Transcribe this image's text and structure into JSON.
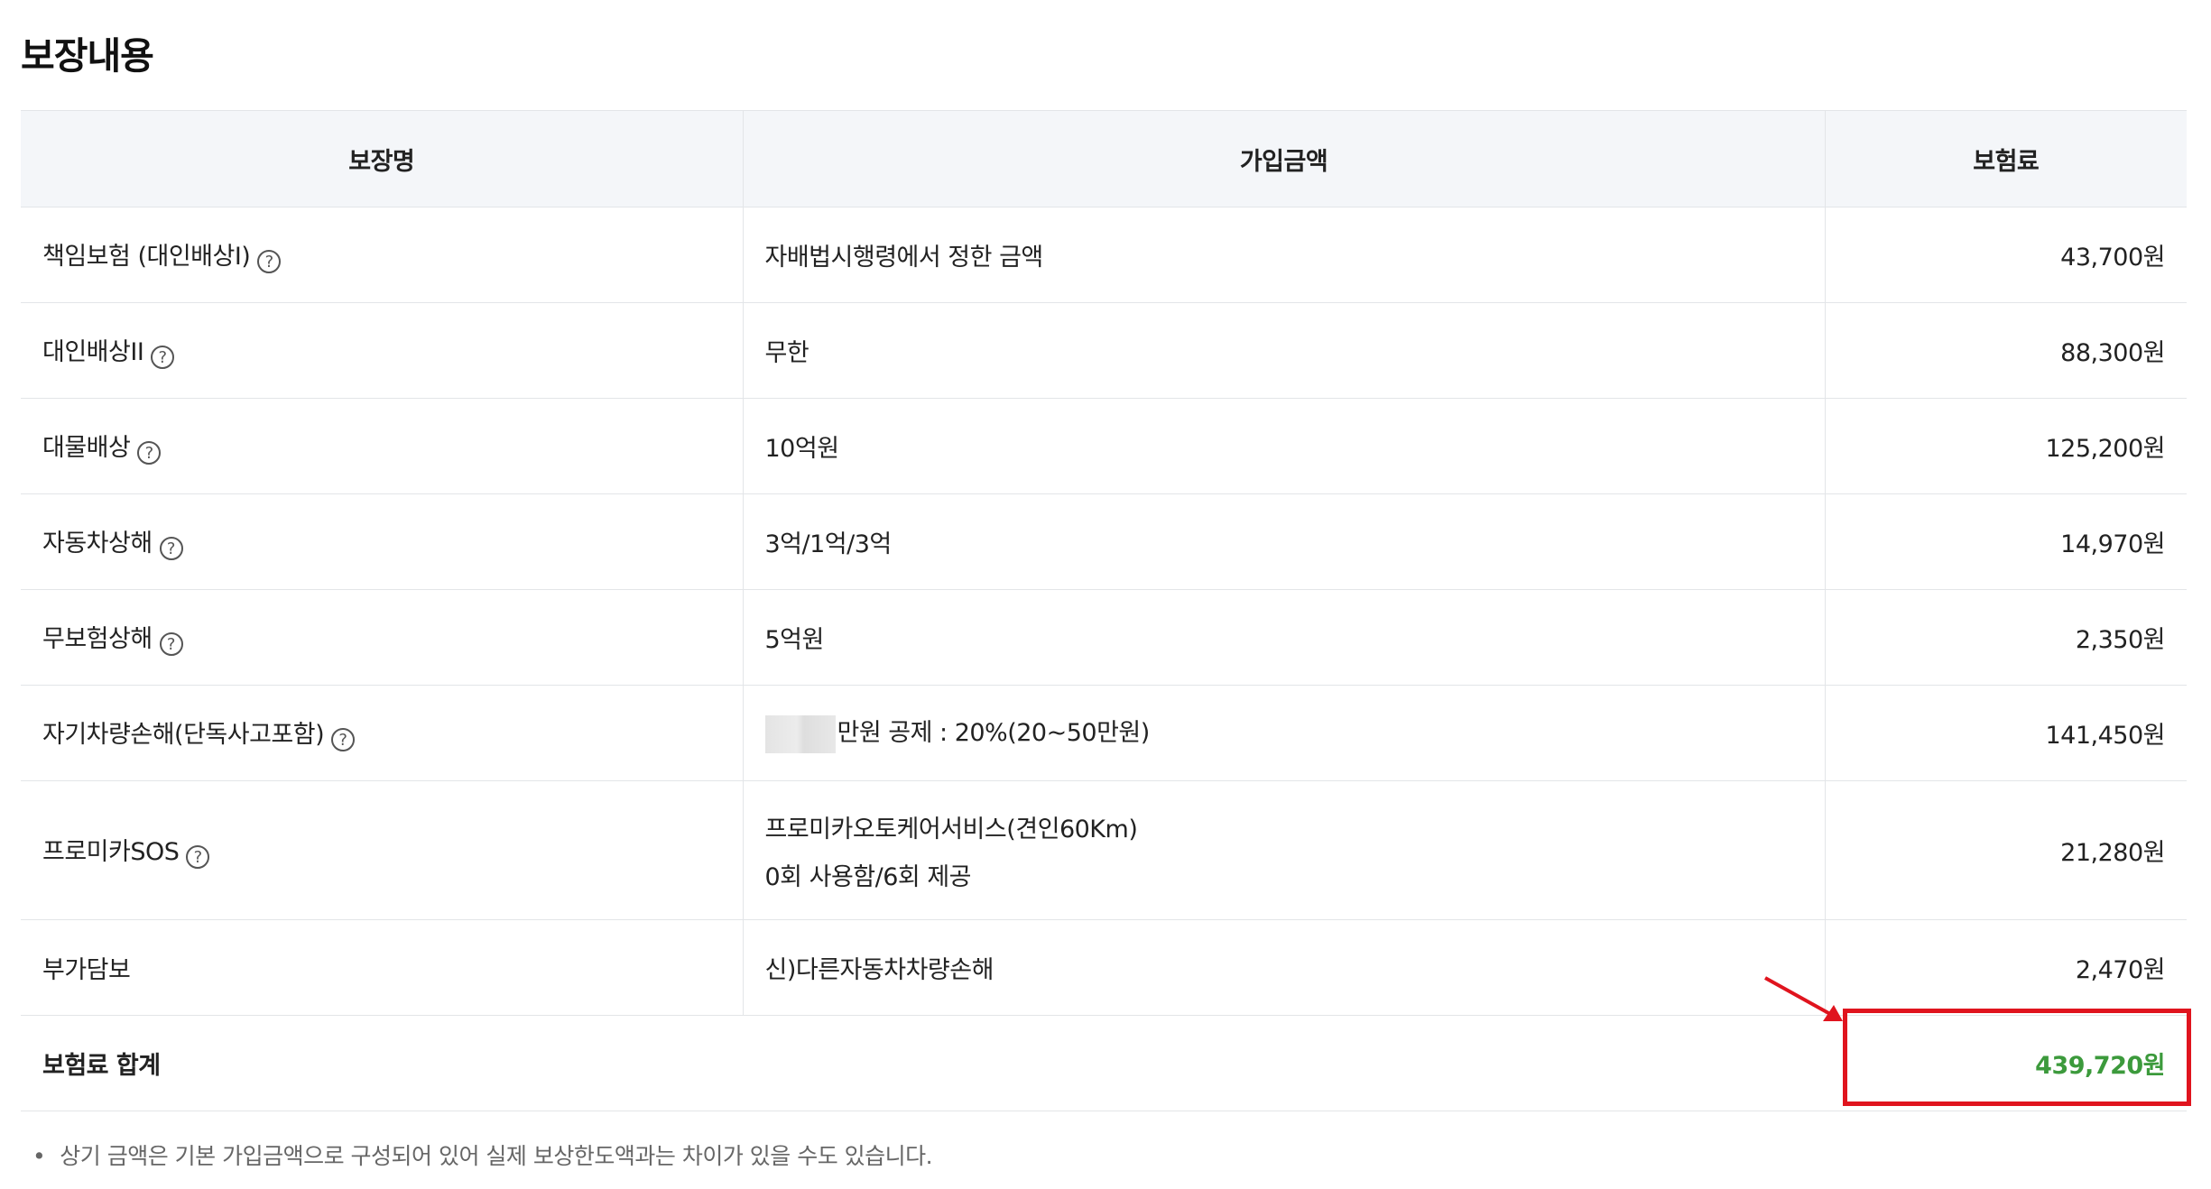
{
  "title": "보장내용",
  "table": {
    "headers": [
      "보장명",
      "가입금액",
      "보험료"
    ],
    "rows": [
      {
        "name": "책임보험 (대인배상I)",
        "has_help": true,
        "amount": "자배법시행령에서 정한 금액",
        "premium": "43,700원"
      },
      {
        "name": "대인배상II",
        "has_help": true,
        "amount": "무한",
        "premium": "88,300원"
      },
      {
        "name": "대물배상",
        "has_help": true,
        "amount": "10억원",
        "premium": "125,200원"
      },
      {
        "name": "자동차상해",
        "has_help": true,
        "amount": "3억/1억/3억",
        "premium": "14,970원"
      },
      {
        "name": "무보험상해",
        "has_help": true,
        "amount": "5억원",
        "premium": "2,350원"
      },
      {
        "name": "자기차량손해(단독사고포함)",
        "has_help": true,
        "amount": "만원 공제 : 20%(20~50만원)",
        "premium": "141,450원"
      },
      {
        "name": "프로미카SOS",
        "has_help": true,
        "amount": "프로미카오토케어서비스(견인60Km)",
        "amount_line2": "0회 사용함/6회 제공",
        "premium": "21,280원"
      },
      {
        "name": "부가담보",
        "has_help": false,
        "amount": "신)다른자동차차량손해",
        "premium": "2,470원"
      }
    ],
    "total": {
      "label": "보험료 합계",
      "value": "439,720원"
    }
  },
  "help_icon": {
    "glyph": "?",
    "icon": "question-circle-icon"
  },
  "note": {
    "bullet": "•",
    "text": "상기 금액은 기본 가입금액으로 구성되어 있어 실제 보상한도액과는 차이가 있을 수도 있습니다."
  },
  "colors": {
    "total_value": "#3c9a3c",
    "highlight": "#e0141e",
    "header_bg": "#f4f6f9"
  }
}
